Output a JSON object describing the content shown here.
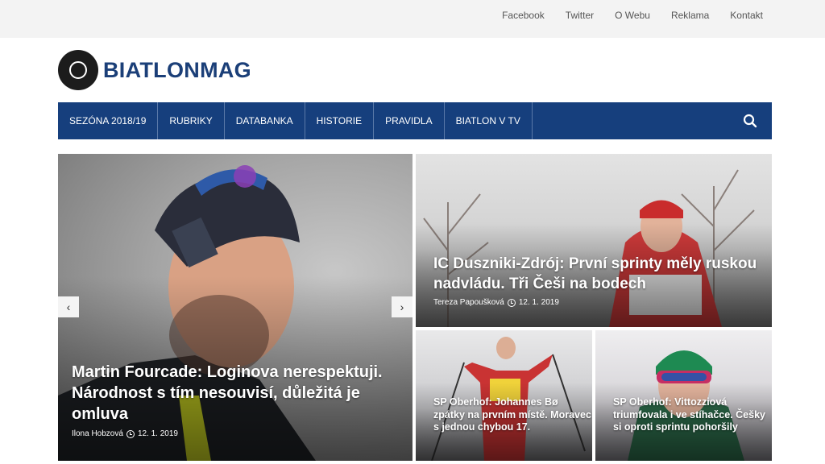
{
  "topbar": {
    "links": [
      "Facebook",
      "Twitter",
      "O Webu",
      "Reklama",
      "Kontakt"
    ]
  },
  "site": {
    "logo_text": "BIATLONMAG"
  },
  "nav": {
    "items": [
      "SEZÓNA 2018/19",
      "RUBRIKY",
      "DATABANKA",
      "HISTORIE",
      "PRAVIDLA",
      "BIATLON V TV"
    ],
    "search_icon": "search-icon"
  },
  "colors": {
    "nav_bg": "#163f7d",
    "logo_blue": "#1b3f78",
    "topbar_bg": "#f3f3f3"
  },
  "slider": {
    "prev_symbol": "‹",
    "next_symbol": "›"
  },
  "articles": [
    {
      "title": "Martin Fourcade: Loginova nerespektuji. Národnost s tím nesouvisí, důležitá je omluva",
      "author": "Ilona Hobzová",
      "date": "12. 1. 2019"
    },
    {
      "title": "IC Duszniki-Zdrój: První sprinty měly ruskou nadvládu. Tři Češi na bodech",
      "author": "Tereza Papoušková",
      "date": "12. 1. 2019"
    },
    {
      "title": "SP Oberhof: Johannes Bø zpátky na prvním místě. Moravec s jednou chybou 17."
    },
    {
      "title": "SP Oberhof: Vittozziová triumfovala i ve stíhačce. Češky si oproti sprintu pohoršily"
    }
  ]
}
